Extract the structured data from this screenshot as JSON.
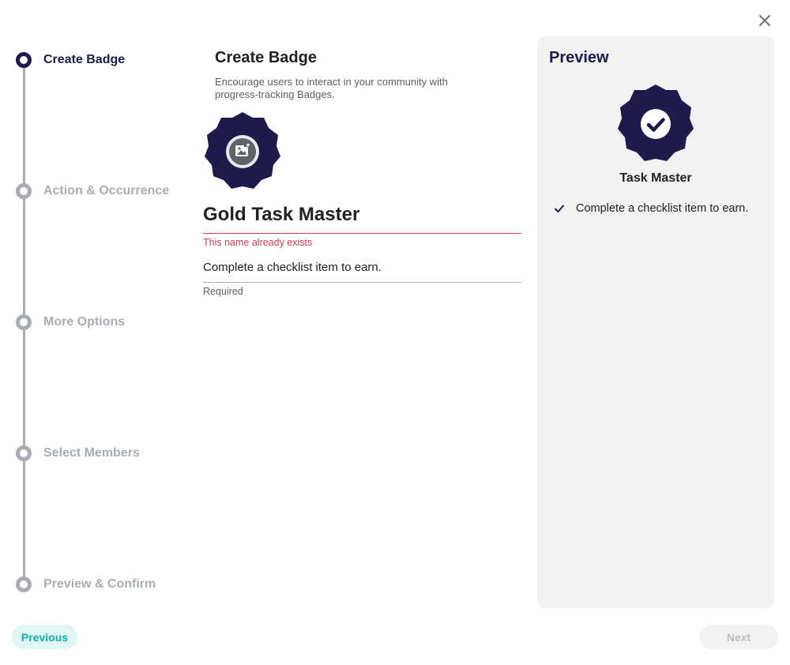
{
  "steps": [
    {
      "label": "Create Badge",
      "state": "active"
    },
    {
      "label": "Action & Occurrence",
      "state": "inactive"
    },
    {
      "label": "More Options",
      "state": "inactive"
    },
    {
      "label": "Select Members",
      "state": "inactive"
    },
    {
      "label": "Preview & Confirm",
      "state": "inactive"
    }
  ],
  "form": {
    "title": "Create Badge",
    "subtitle": "Encourage users to interact in your community with progress-tracking Badges.",
    "badge_icon": "image-upload-icon",
    "name_value": "Gold Task Master",
    "name_error": "This name already exists",
    "description_value": "Complete a checklist item to earn.",
    "description_helper": "Required"
  },
  "preview": {
    "title": "Preview",
    "badge_icon": "check-icon",
    "badge_name": "Task Master",
    "requirement": "Complete a checklist item to earn."
  },
  "footer": {
    "previous_label": "Previous",
    "next_label": "Next",
    "next_disabled": true
  },
  "colors": {
    "primary": "#1d1b4b",
    "error": "#d23c5a",
    "accent": "#14b0ab",
    "inactive": "#a7adb3",
    "panel_bg": "#f2f2f2"
  }
}
